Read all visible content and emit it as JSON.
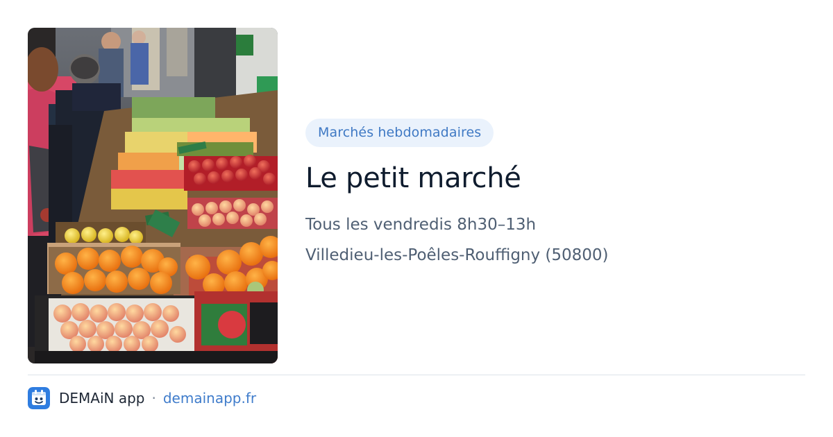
{
  "card": {
    "photo": {
      "icon": "market-photo",
      "description_hidden": true
    },
    "category": "Marchés hebdomadaires",
    "title": "Le petit marché",
    "schedule": "Tous les vendredis 8h30–13h",
    "location": "Villedieu-les-Poêles-Rouffigny (50800)"
  },
  "footer": {
    "logo_icon": "demain-app-logo-icon",
    "app_name": "DEMAiN app",
    "separator": "·",
    "domain": "demainapp.fr"
  },
  "colors": {
    "badge_bg": "#eaf2fc",
    "badge_text": "#3f79c4",
    "title": "#0f1c2e",
    "body_text": "#4f5f73",
    "link": "#3f7ccb",
    "logo_blue": "#2f7de0"
  }
}
